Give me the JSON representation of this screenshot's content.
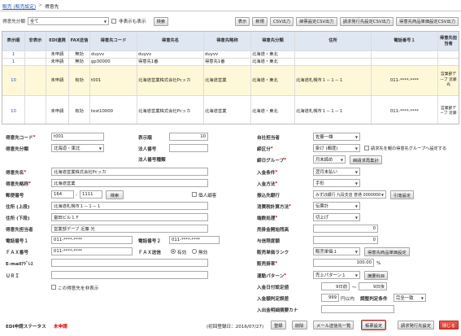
{
  "breadcrumb": {
    "root": "販売 (販売設定)",
    "sep": ">",
    "current": "得意先"
  },
  "filter": {
    "category_label": "得意先分類",
    "category_value": "全て",
    "show_deleted_label": "非表示も表示",
    "search_button": "検索",
    "display_button": "表示",
    "add_button": "新規",
    "csv_button": "CSV出力",
    "terms_csv_button": "締票設定CSV出力",
    "delivery_csv_button": "請求発行先設定CSV出力",
    "product_price_csv_button": "得意先商品単価設定CSV出力"
  },
  "table": {
    "headers": [
      "表示順",
      "非表示",
      "EDI連携",
      "FAX送信",
      "得意先コード",
      "得意先名",
      "得意先略称",
      "得意先分類",
      "住所",
      "電話番号１",
      "得意先担当者"
    ],
    "rows": [
      {
        "order": "1",
        "hidden": "",
        "edi": "未申請",
        "fax": "無効",
        "code": "duyvv",
        "name": "duyvv",
        "short": "duyvv",
        "category": "北海道・東北",
        "address": "",
        "tel": "",
        "staff": ""
      },
      {
        "order": "1",
        "hidden": "",
        "edi": "未申請",
        "fax": "無効",
        "code": "gp30000",
        "name": "得意先1番",
        "short": "得意先1番",
        "category": "北海道・東北",
        "address": "",
        "tel": "",
        "staff": ""
      },
      {
        "order": "10",
        "hidden": "",
        "edi": "未申請",
        "fax": "有効",
        "code": "t001",
        "name": "北海道営業株式会社Pcッカ",
        "short": "北海道営業",
        "category": "北海道・東北",
        "address": "北海道札幌市１－１－１",
        "tel": "011-****-****",
        "staff": "営業部デーブ 近藤 光"
      },
      {
        "order": "10",
        "hidden": "",
        "edi": "未申請",
        "fax": "有効",
        "code": "test10000",
        "name": "北海道営業株式会社Pcッカ",
        "short": "北海道営業",
        "category": "北海道・東北",
        "address": "北海道札幌市１－１－１",
        "tel": "011-****-****",
        "staff": "営業部デーブ 近藤"
      }
    ]
  },
  "form": {
    "code_label": "得意先コード",
    "code_value": "t001",
    "category_label": "得意先分類",
    "category_value": "北海道・東北",
    "order_label": "表示順",
    "order_value": "10",
    "corp_no_label": "法人番号",
    "corp_no_value": "",
    "corp_kind_label": "法人番号種類",
    "corp_kind_value": "",
    "name_label": "得意先名",
    "name_value": "北海道営業株式会社Pcッカ",
    "short_label": "得意先略称",
    "short_value": "北海道営業",
    "kana_label": "得意先名カナ",
    "kana_value": "",
    "zip_label": "郵便番号",
    "zip1": "164",
    "zip2": "1111",
    "zip_search_button": "検索",
    "personal_label": "個人顧客",
    "addr1_label": "住所 (上段)",
    "addr1_value": "北海道札幌市１－１－１",
    "addr2_label": "住所 (下段)",
    "addr2_value": "富田ビル１Ｆ",
    "staff_label": "得意先担当者",
    "staff_value": "営業部デーブ 近藤 光",
    "tel1_label": "電話番号１",
    "tel1_value": "011-****-****",
    "tel2_label": "電話番号２",
    "tel2_value": "011-****-****",
    "fax_label": "ＦＡＸ番号",
    "fax_value": "011-****-****",
    "fax_send_label": "ＦＡＸ送信",
    "fax_on": "有効",
    "fax_off": "無効",
    "email_label": "E-mailｱﾄﾞﾚｽ",
    "email_value": "",
    "url_label": "ＵＲＩ",
    "url_value": "",
    "hide_label": "この得意先を非表示",
    "company_label": "自社担当者",
    "company_value": "佐藤一雄",
    "closing_label": "締区分",
    "closing_value": "掛け (都度)",
    "billing_group_label": "請求先を親の得意先グループへ設定する",
    "close_group_label": "締日グループ",
    "close_group_value": "月末締め",
    "close_btn": "締請求再集計",
    "payment_label": "入金条件",
    "payment_value": "翌月末払い",
    "method_label": "入金方法",
    "method_value": "手形",
    "bank_label": "振込先銀行",
    "bank_value": "みずほ銀行 九段支店 普通 0000000",
    "bank_btn": "引落設定",
    "tax_calc_label": "消費税計算方法",
    "tax_calc_value": "伝票計",
    "round_label": "端数処理",
    "round_value": "切上げ",
    "sales_start_label": "売掛金開始残高",
    "sales_start_value": "0",
    "credit_label": "与信限度額",
    "credit_value": "0",
    "price_rank_label": "販売単価ランク",
    "price_rank_value": "販売単価１",
    "price_rank_btn": "得意先商品単価設定",
    "sales_rate_label": "販売掛率",
    "sales_rate_value": "100.00",
    "sales_rate_unit": "%",
    "pattern_label": "運動パターン",
    "pattern_value": "売上パターン１",
    "pattern_btn": "摘要科目",
    "due_label": "入金日付設定値",
    "due_from": "9日前",
    "due_sep": "～",
    "due_to": "9日後",
    "fee_label": "入金額判定誤差",
    "fee_value": "999",
    "fee_unit": "円以内",
    "fee_sub_label": "調整判定条件",
    "fee_sub_value": "完全一致",
    "bank_no_label": "入出金明細摘要カナ",
    "bank_no_value": ""
  },
  "footer": {
    "edi_label": "EDI申請ステータス",
    "edi_value": "未申請",
    "updated": "(初回登録日：2016/07/27)",
    "register": "登録",
    "delete": "削除",
    "mail_list": "メール送信先一覧",
    "terms": "帳票設定",
    "delivery": "請求発行先設定",
    "close": "閉じる"
  },
  "colors": {
    "header_bg": "#dfe7f2",
    "selected_row": "#fff8d8",
    "required": "#dd0000",
    "highlight": "#e02020"
  }
}
